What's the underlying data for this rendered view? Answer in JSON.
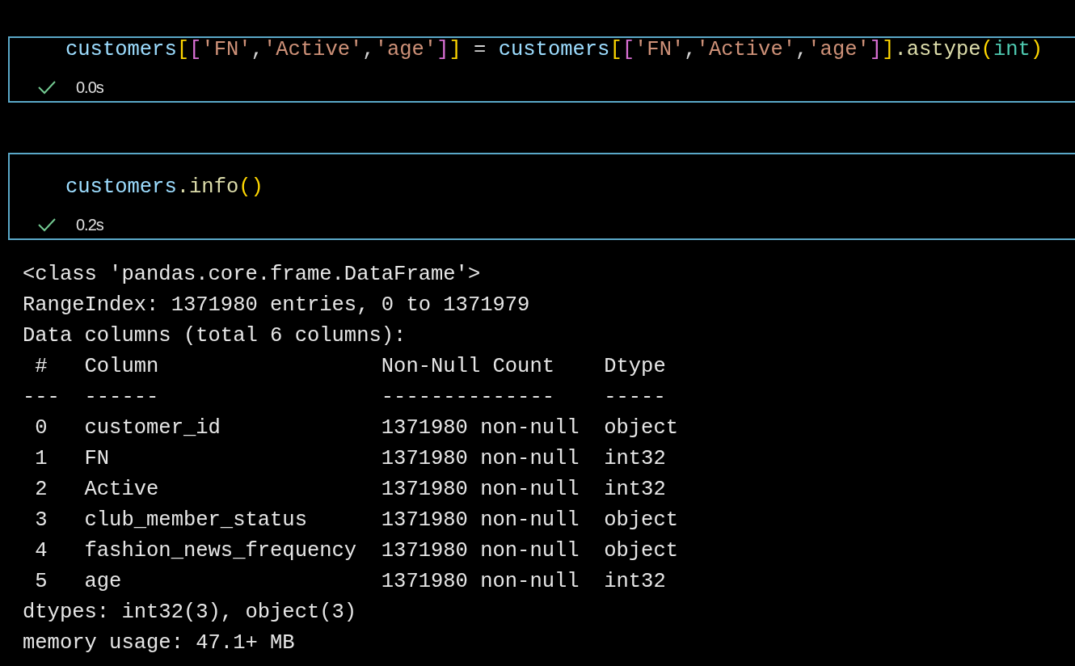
{
  "cells": [
    {
      "code": [
        {
          "kind": "variable",
          "text": "customers"
        },
        {
          "kind": "bracket1",
          "text": "["
        },
        {
          "kind": "bracket2",
          "text": "["
        },
        {
          "kind": "string",
          "text": "'FN'"
        },
        {
          "kind": "plain",
          "text": ","
        },
        {
          "kind": "string",
          "text": "'Active'"
        },
        {
          "kind": "plain",
          "text": ","
        },
        {
          "kind": "string",
          "text": "'age'"
        },
        {
          "kind": "bracket2",
          "text": "]"
        },
        {
          "kind": "bracket1",
          "text": "]"
        },
        {
          "kind": "plain",
          "text": " = "
        },
        {
          "kind": "variable",
          "text": "customers"
        },
        {
          "kind": "bracket1",
          "text": "["
        },
        {
          "kind": "bracket2",
          "text": "["
        },
        {
          "kind": "string",
          "text": "'FN'"
        },
        {
          "kind": "plain",
          "text": ","
        },
        {
          "kind": "string",
          "text": "'Active'"
        },
        {
          "kind": "plain",
          "text": ","
        },
        {
          "kind": "string",
          "text": "'age'"
        },
        {
          "kind": "bracket2",
          "text": "]"
        },
        {
          "kind": "bracket1",
          "text": "]"
        },
        {
          "kind": "function",
          "text": ".astype"
        },
        {
          "kind": "bracket1",
          "text": "("
        },
        {
          "kind": "type",
          "text": "int"
        },
        {
          "kind": "bracket1",
          "text": ")"
        }
      ],
      "succeeded": true,
      "time": "0.0s"
    },
    {
      "code": [
        {
          "kind": "variable",
          "text": "customers"
        },
        {
          "kind": "function",
          "text": ".info"
        },
        {
          "kind": "bracket1",
          "text": "()"
        }
      ],
      "succeeded": true,
      "time": "0.2s",
      "output": [
        "<class 'pandas.core.frame.DataFrame'>",
        "RangeIndex: 1371980 entries, 0 to 1371979",
        "Data columns (total 6 columns):",
        " #   Column                  Non-Null Count    Dtype",
        "---  ------                  --------------    -----",
        " 0   customer_id             1371980 non-null  object",
        " 1   FN                      1371980 non-null  int32",
        " 2   Active                  1371980 non-null  int32",
        " 3   club_member_status      1371980 non-null  object",
        " 4   fashion_news_frequency  1371980 non-null  object",
        " 5   age                     1371980 non-null  int32",
        "dtypes: int32(3), object(3)",
        "memory usage: 47.1+ MB"
      ]
    }
  ]
}
